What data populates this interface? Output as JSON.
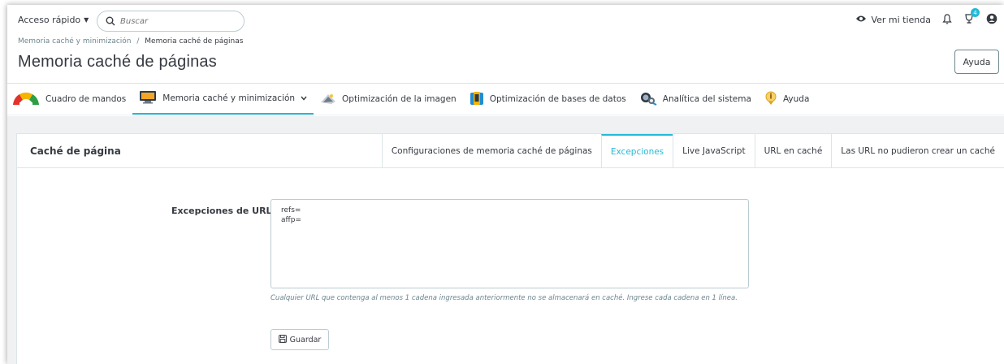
{
  "header": {
    "quick_access_label": "Acceso rápido",
    "search_placeholder": "Buscar",
    "view_store_label": "Ver mi tienda",
    "trophy_badge_count": "4"
  },
  "breadcrumb": {
    "parent": "Memoria caché y minimización",
    "separator": "/",
    "current": "Memoria caché de páginas"
  },
  "page": {
    "title": "Memoria caché de páginas",
    "help_button_label": "Ayuda"
  },
  "module_nav": [
    {
      "label": "Cuadro de mandos",
      "icon": "gauge-icon",
      "active": false
    },
    {
      "label": "Memoria caché y minimización",
      "icon": "monitor-icon",
      "active": true,
      "has_dropdown": true
    },
    {
      "label": "Optimización de la imagen",
      "icon": "image-optimization-icon",
      "active": false
    },
    {
      "label": "Optimización de bases de datos",
      "icon": "database-icon",
      "active": false
    },
    {
      "label": "Analítica del sistema",
      "icon": "system-analytics-icon",
      "active": false
    },
    {
      "label": "Ayuda",
      "icon": "help-info-icon",
      "active": false
    }
  ],
  "card": {
    "title": "Caché de página",
    "tabs": [
      {
        "label": "Configuraciones de memoria caché de páginas",
        "active": false
      },
      {
        "label": "Excepciones",
        "active": true
      },
      {
        "label": "Live JavaScript",
        "active": false
      },
      {
        "label": "URL en caché",
        "active": false
      },
      {
        "label": "Las URL no pudieron crear un caché",
        "active": false
      }
    ]
  },
  "form": {
    "url_exceptions_label": "Excepciones de URL",
    "url_exceptions_value": "refs=\naffp=",
    "help_text": "Cualquier URL que contenga al menos 1 cadena ingresada anteriormente no se almacenará en caché. Ingrese cada cadena en 1 línea.",
    "save_button_label": "Guardar"
  },
  "colors": {
    "accent": "#25b9d7",
    "text": "#363a41",
    "muted": "#6c868e",
    "border": "#bbcdd2",
    "content_bg": "#eff1f2"
  }
}
